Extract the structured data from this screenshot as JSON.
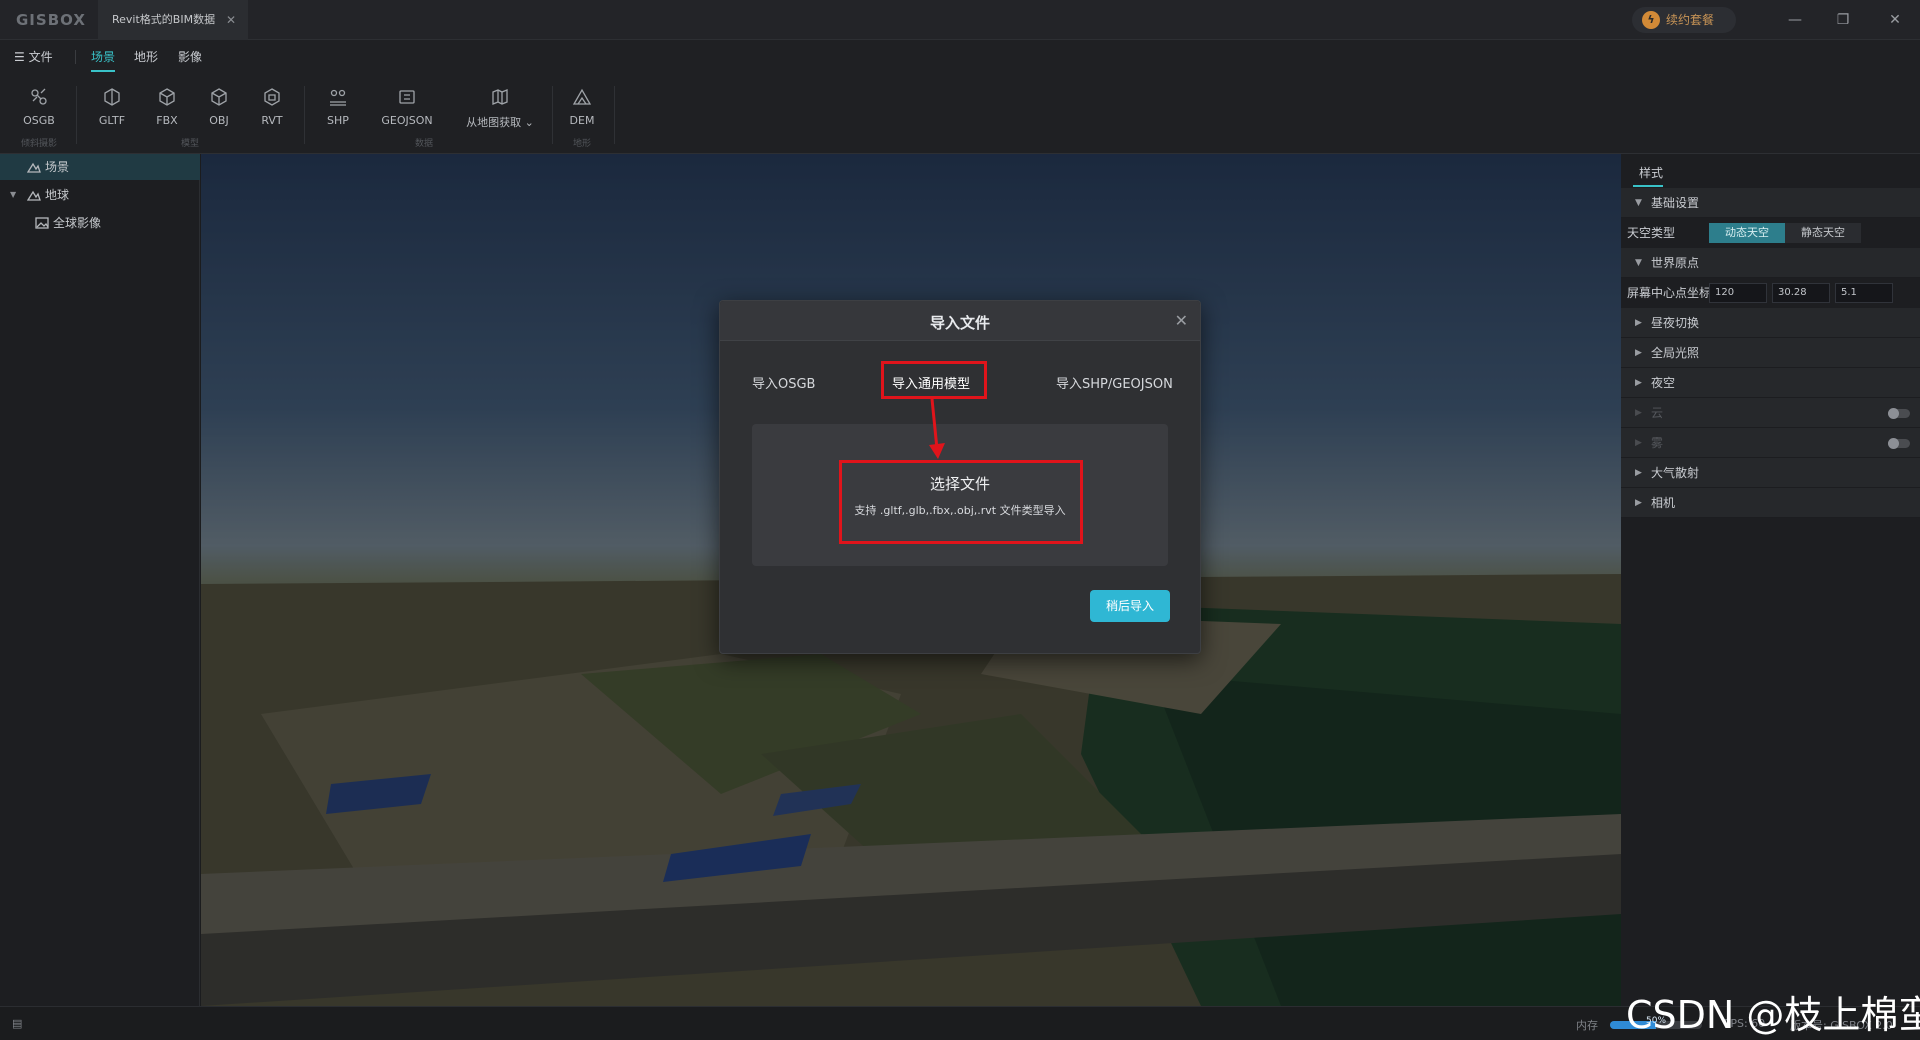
{
  "app": {
    "logo": "GISBOX",
    "document_tab": "Revit格式的BIM数据",
    "plan_button": "续约套餐"
  },
  "menu": {
    "file": "文件",
    "tabs": [
      "场景",
      "地形",
      "影像"
    ],
    "active_tab": "场景"
  },
  "toolbar": {
    "tools": [
      "OSGB",
      "GLTF",
      "FBX",
      "OBJ",
      "RVT",
      "SHP",
      "GEOJSON",
      "从地图获取",
      "DEM"
    ],
    "groups": [
      "倾斜摄影",
      "模型",
      "数据",
      "地形"
    ]
  },
  "sidebar": {
    "scene": "场景",
    "earth": "地球",
    "imagery": "全球影像"
  },
  "right_panel": {
    "tab": "样式",
    "basic_settings": "基础设置",
    "sky_type_label": "天空类型",
    "sky_options": [
      "动态天空",
      "静态天空"
    ],
    "sky_selected": "动态天空",
    "world_origin": "世界原点",
    "screen_center_label": "屏幕中心点坐标",
    "coords": [
      "120",
      "30.28",
      "5.1"
    ],
    "sections": [
      "昼夜切换",
      "全局光照",
      "夜空",
      "云",
      "雾",
      "大气散射",
      "相机"
    ]
  },
  "dialog": {
    "title": "导入文件",
    "tabs": [
      "导入OSGB",
      "导入通用模型",
      "导入SHP/GEOJSON"
    ],
    "active_tab": "导入通用模型",
    "dropzone_title": "选择文件",
    "dropzone_hint": "支持 .gltf,.glb,.fbx,.obj,.rvt 文件类型导入",
    "later_button": "稍后导入"
  },
  "statusbar": {
    "memory_label": "内存",
    "memory_value": "50%",
    "memory_fraction": 0.5,
    "fps": "FPS: 60",
    "version": "版本号: GISBOX 2.0"
  },
  "watermark": "CSDN @枝上棉蛮",
  "colors": {
    "accent": "#39c2c8",
    "highlight": "#e0141b",
    "primary_button": "#2fb7d4"
  }
}
